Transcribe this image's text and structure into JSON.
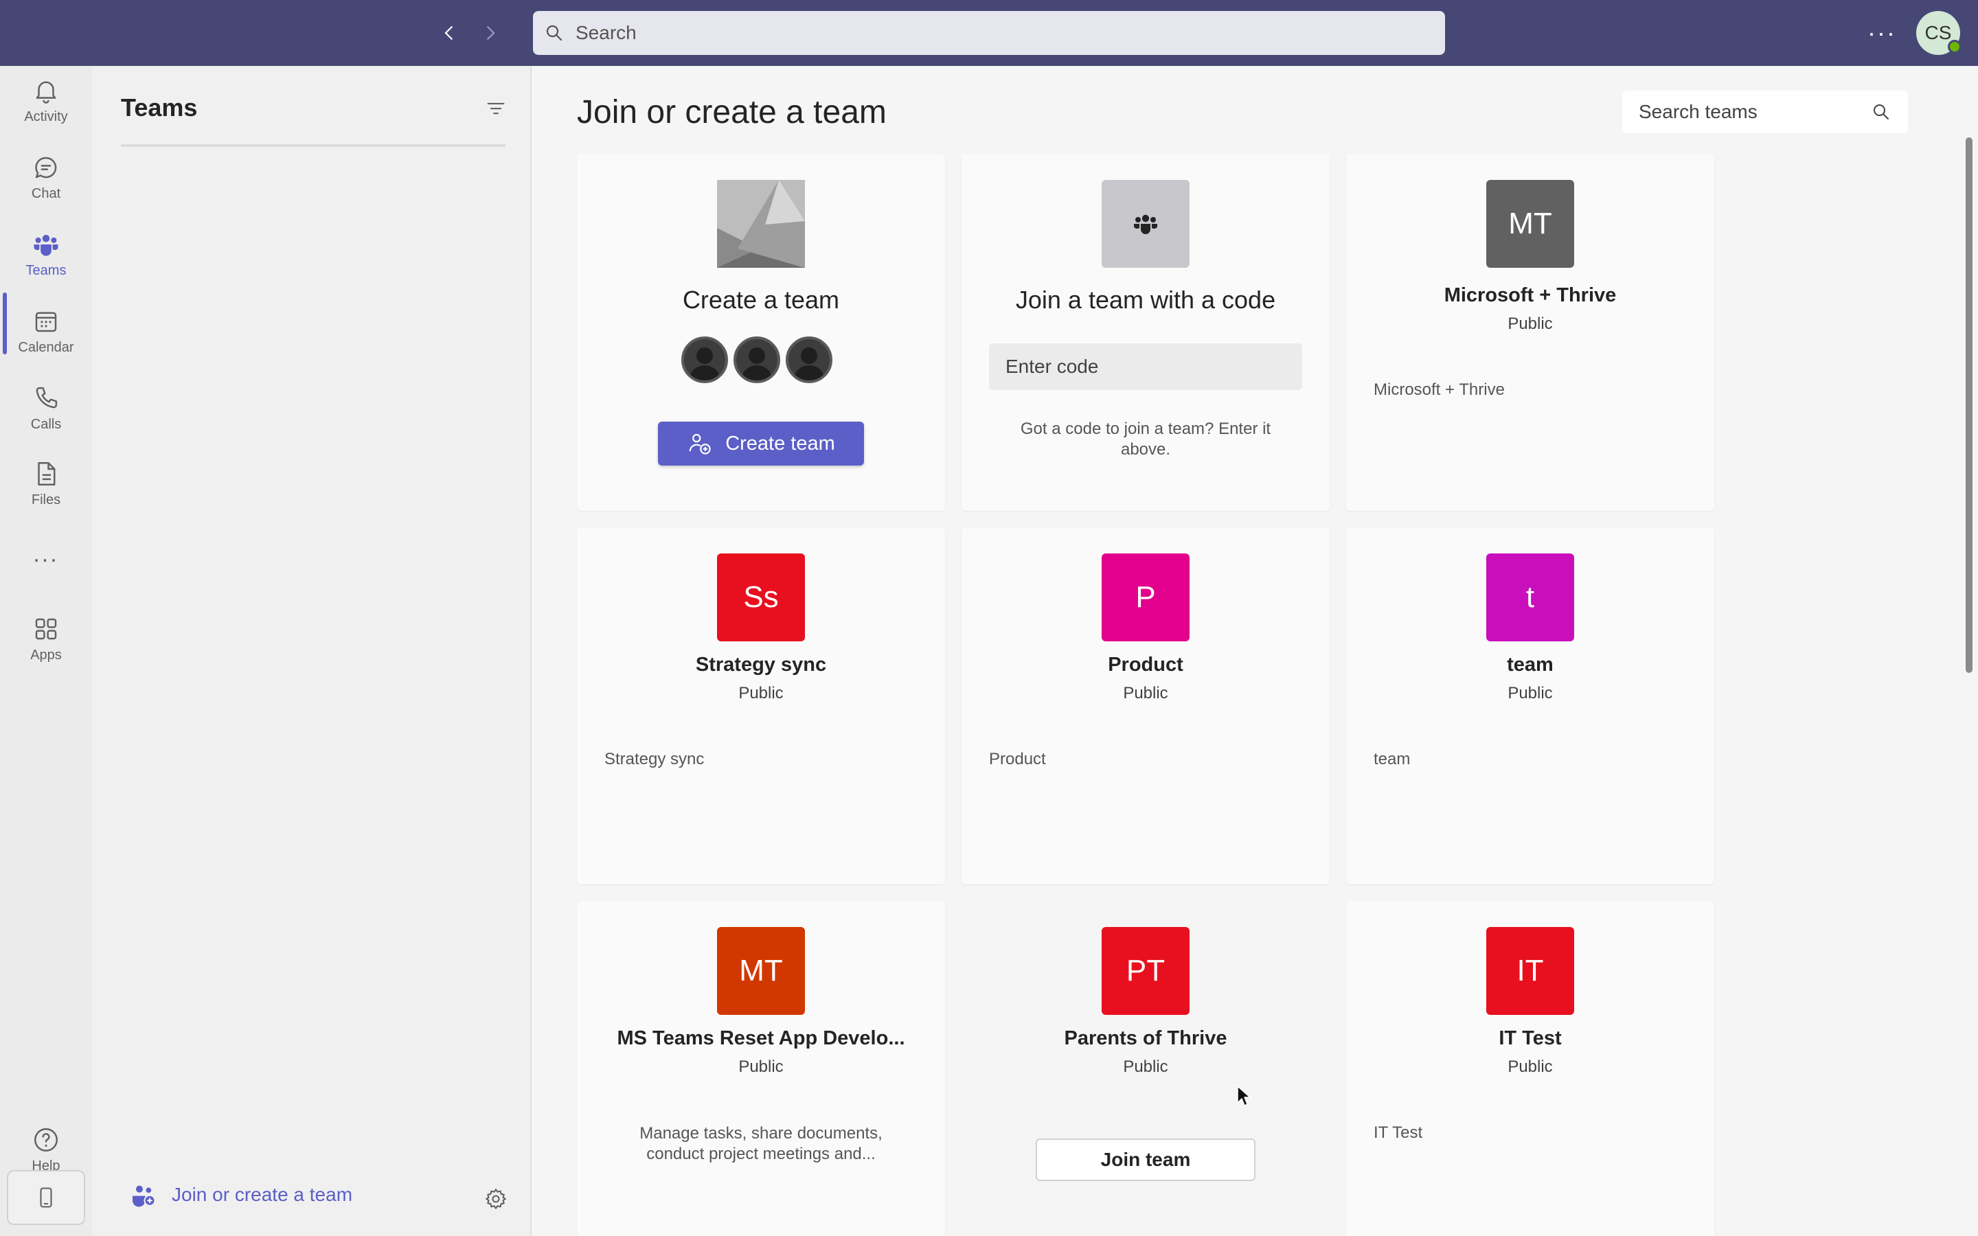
{
  "titlebar": {
    "search_placeholder": "Search",
    "avatar_initials": "CS",
    "bg_color": "#464775"
  },
  "rail": {
    "items": [
      {
        "label": "Activity",
        "icon": "bell-icon"
      },
      {
        "label": "Chat",
        "icon": "chat-icon"
      },
      {
        "label": "Teams",
        "icon": "teams-icon",
        "active": true
      },
      {
        "label": "Calendar",
        "icon": "calendar-icon"
      },
      {
        "label": "Calls",
        "icon": "phone-icon"
      },
      {
        "label": "Files",
        "icon": "file-icon"
      }
    ],
    "more_label": "...",
    "apps_label": "Apps",
    "help_label": "Help",
    "accent": "#5b5fc7"
  },
  "leftpane": {
    "title": "Teams",
    "join_label": "Join or create a team"
  },
  "main": {
    "title": "Join or create a team",
    "search_teams_placeholder": "Search teams",
    "create_card": {
      "title": "Create a team",
      "button_label": "Create team"
    },
    "code_card": {
      "title": "Join a team with a code",
      "input_placeholder": "Enter code",
      "help_text": "Got a code to join a team? Enter it above."
    },
    "teams": [
      {
        "initials": "MT",
        "name": "Microsoft + Thrive",
        "visibility": "Public",
        "description": "Microsoft + Thrive",
        "color": "#616161"
      },
      {
        "initials": "Ss",
        "name": "Strategy sync",
        "visibility": "Public",
        "description": "Strategy sync",
        "color": "#e8101e"
      },
      {
        "initials": "P",
        "name": "Product",
        "visibility": "Public",
        "description": "Product",
        "color": "#e3008c"
      },
      {
        "initials": "t",
        "name": "team",
        "visibility": "Public",
        "description": "team",
        "color": "#c80fbb"
      },
      {
        "initials": "MT",
        "name": "MS Teams Reset App Develo...",
        "visibility": "Public",
        "description": "Manage tasks, share documents, conduct project meetings and...",
        "color": "#d13800"
      },
      {
        "initials": "PT",
        "name": "Parents of Thrive",
        "visibility": "Public",
        "join_label": "Join team",
        "color": "#e8101e"
      },
      {
        "initials": "IT",
        "name": "IT Test",
        "visibility": "Public",
        "description": "IT Test",
        "color": "#e8101e"
      }
    ]
  }
}
